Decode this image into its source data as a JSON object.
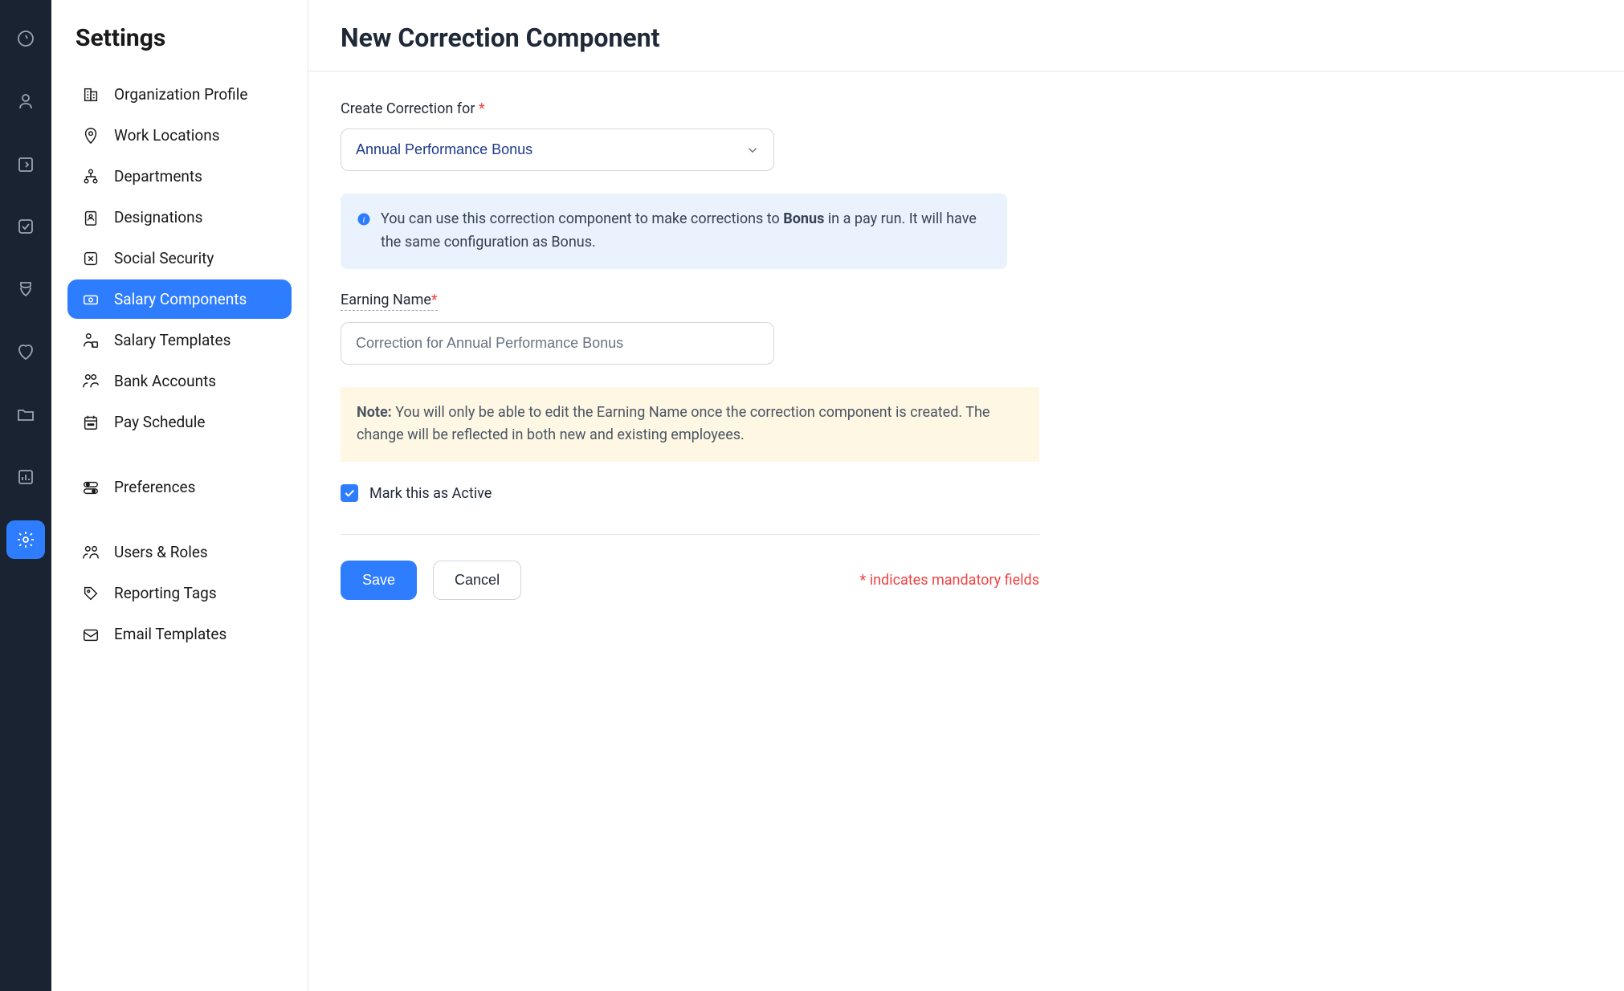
{
  "sidebar": {
    "title": "Settings",
    "items": [
      {
        "label": "Organization Profile"
      },
      {
        "label": "Work Locations"
      },
      {
        "label": "Departments"
      },
      {
        "label": "Designations"
      },
      {
        "label": "Social Security"
      },
      {
        "label": "Salary Components"
      },
      {
        "label": "Salary Templates"
      },
      {
        "label": "Bank Accounts"
      },
      {
        "label": "Pay Schedule"
      },
      {
        "label": "Preferences"
      },
      {
        "label": "Users & Roles"
      },
      {
        "label": "Reporting Tags"
      },
      {
        "label": "Email Templates"
      }
    ]
  },
  "main": {
    "title": "New Correction Component",
    "correctionLabel": "Create Correction for ",
    "correctionValue": "Annual Performance Bonus",
    "infoText1": "You can use this correction component to make corrections to ",
    "infoBold": "Bonus",
    "infoText2": " in a pay run. It will have the same configuration as Bonus.",
    "earningLabel": "Earning Name",
    "earningValue": "Correction for Annual Performance Bonus",
    "noteBold": "Note:",
    "noteText": " You will only be able to edit the Earning Name once the correction component is created. The change will be reflected in both new and existing employees.",
    "activeLabel": "Mark this as Active",
    "activeChecked": true,
    "saveLabel": "Save",
    "cancelLabel": "Cancel",
    "mandatoryNote": "* indicates mandatory fields"
  }
}
